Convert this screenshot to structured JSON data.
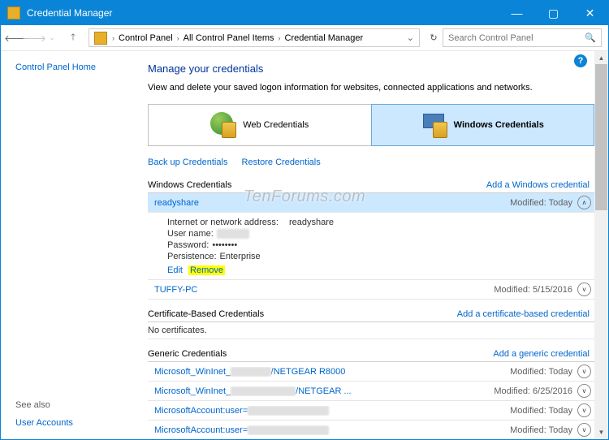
{
  "window": {
    "title": "Credential Manager"
  },
  "nav": {
    "crumbs": [
      "Control Panel",
      "All Control Panel Items",
      "Credential Manager"
    ],
    "search_placeholder": "Search Control Panel"
  },
  "left": {
    "home": "Control Panel Home",
    "see_also": "See also",
    "user_accounts": "User Accounts"
  },
  "page": {
    "title": "Manage your credentials",
    "subtitle": "View and delete your saved logon information for websites, connected applications and networks."
  },
  "tabs": {
    "web": "Web Credentials",
    "win": "Windows Credentials"
  },
  "links": {
    "backup": "Back up Credentials",
    "restore": "Restore Credentials"
  },
  "sections": {
    "win": {
      "label": "Windows Credentials",
      "add": "Add a Windows credential"
    },
    "cert": {
      "label": "Certificate-Based Credentials",
      "add": "Add a certificate-based credential",
      "empty": "No certificates."
    },
    "generic": {
      "label": "Generic Credentials",
      "add": "Add a generic credential"
    }
  },
  "win_creds": [
    {
      "name": "readyshare",
      "modified": "Modified: Today",
      "expanded": true,
      "detail": {
        "addr_label": "Internet or network address:",
        "addr_value": "readyshare",
        "user_label": "User name:",
        "user_value": "",
        "pass_label": "Password:",
        "pass_value": "••••••••",
        "persist_label": "Persistence:",
        "persist_value": "Enterprise",
        "edit": "Edit",
        "remove": "Remove"
      }
    },
    {
      "name": "TUFFY-PC",
      "modified": "Modified: 5/15/2016",
      "expanded": false
    }
  ],
  "generic_creds": [
    {
      "name_prefix": "Microsoft_WinInet_",
      "name_suffix": "/NETGEAR R8000",
      "modified": "Modified: Today"
    },
    {
      "name_prefix": "Microsoft_WinInet_",
      "name_suffix": "/NETGEAR ...",
      "modified": "Modified: 6/25/2016"
    },
    {
      "name_prefix": "MicrosoftAccount:user=",
      "name_suffix": "",
      "modified": "Modified: Today"
    },
    {
      "name_prefix": "MicrosoftAccount:user=",
      "name_suffix": "",
      "modified": "Modified: Today"
    }
  ],
  "watermark": "TenForums.com"
}
